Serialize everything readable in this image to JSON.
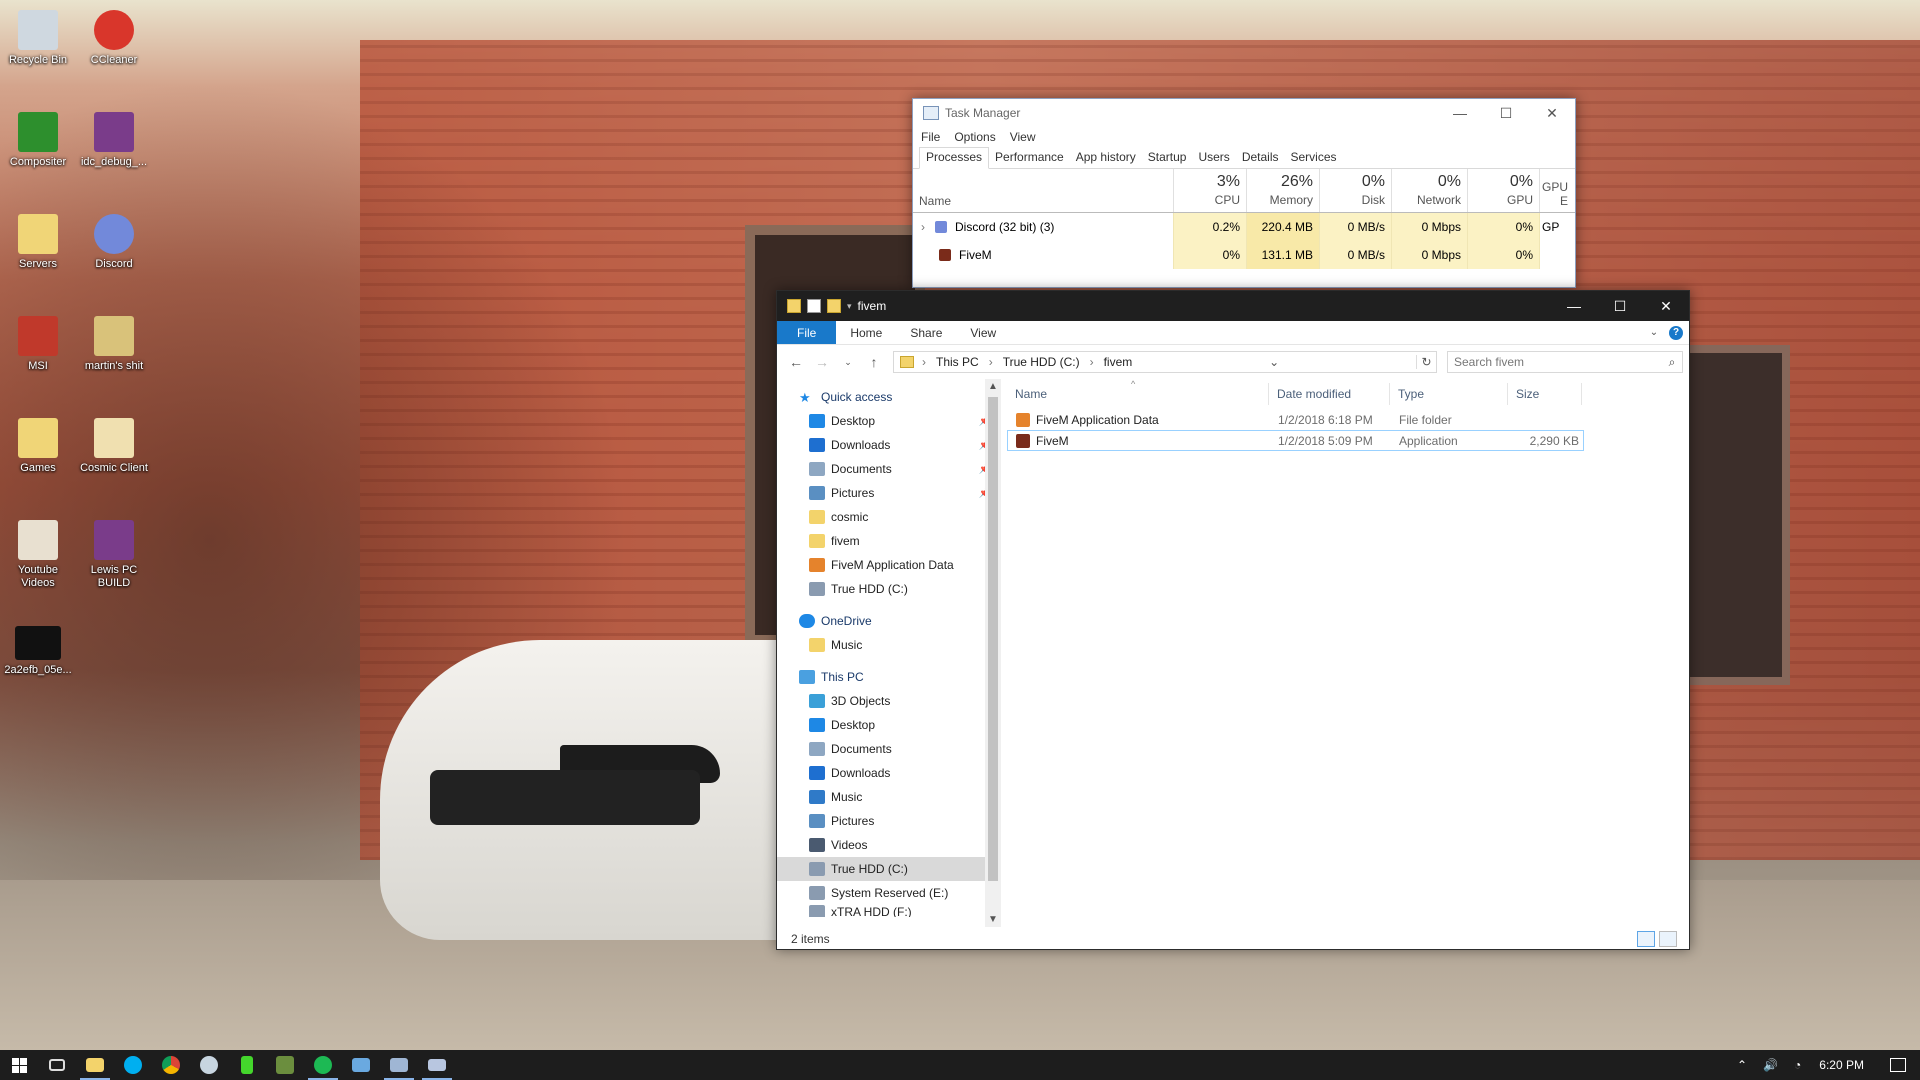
{
  "desktop": {
    "icons": [
      {
        "label": "Recycle Bin",
        "color": "#cfd8e0"
      },
      {
        "label": "CCleaner",
        "color": "#d9362b"
      },
      {
        "label": "Compositer",
        "color": "#2d8f2d"
      },
      {
        "label": "idc_debug_...",
        "color": "#7a3c8a"
      },
      {
        "label": "Servers",
        "color": "#f0d577"
      },
      {
        "label": "Discord",
        "color": "#7289da"
      },
      {
        "label": "MSI",
        "color": "#c0392b"
      },
      {
        "label": "martin's shit",
        "color": "#d9c27a"
      },
      {
        "label": "Games",
        "color": "#f0d577"
      },
      {
        "label": "Cosmic Client",
        "color": "#f0e0b0"
      },
      {
        "label": "Youtube Videos",
        "color": "#e8e0d0"
      },
      {
        "label": "Lewis PC BUILD",
        "color": "#7a3c8a"
      },
      {
        "label": "2a2efb_05e...",
        "color": "#111111"
      }
    ]
  },
  "task_manager": {
    "title": "Task Manager",
    "menu": [
      "File",
      "Options",
      "View"
    ],
    "tabs": [
      "Processes",
      "Performance",
      "App history",
      "Startup",
      "Users",
      "Details",
      "Services"
    ],
    "columns": {
      "name": "Name",
      "cpu": {
        "pct": "3%",
        "label": "CPU"
      },
      "memory": {
        "pct": "26%",
        "label": "Memory"
      },
      "disk": {
        "pct": "0%",
        "label": "Disk"
      },
      "network": {
        "pct": "0%",
        "label": "Network"
      },
      "gpu": {
        "pct": "0%",
        "label": "GPU"
      },
      "gpu_engine": "GPU E"
    },
    "rows": [
      {
        "name": "Discord (32 bit) (3)",
        "cpu": "0.2%",
        "memory": "220.4 MB",
        "disk": "0 MB/s",
        "network": "0 Mbps",
        "gpu": "0%",
        "gpu_engine": "GP"
      },
      {
        "name": "FiveM",
        "cpu": "0%",
        "memory": "131.1 MB",
        "disk": "0 MB/s",
        "network": "0 Mbps",
        "gpu": "0%",
        "gpu_engine": ""
      }
    ]
  },
  "explorer": {
    "title": "fivem",
    "ribbon": [
      "File",
      "Home",
      "Share",
      "View"
    ],
    "breadcrumb": [
      "This PC",
      "True HDD (C:)",
      "fivem"
    ],
    "search_placeholder": "Search fivem",
    "nav": {
      "quick_access": "Quick access",
      "quick_items": [
        {
          "label": "Desktop",
          "pinned": true,
          "color": "#1e88e5"
        },
        {
          "label": "Downloads",
          "pinned": true,
          "color": "#1e6fd0"
        },
        {
          "label": "Documents",
          "pinned": true,
          "color": "#8ea7c2"
        },
        {
          "label": "Pictures",
          "pinned": true,
          "color": "#5a8fc2"
        },
        {
          "label": "cosmic",
          "pinned": false,
          "color": "#f3d36b"
        },
        {
          "label": "fivem",
          "pinned": false,
          "color": "#f3d36b"
        },
        {
          "label": "FiveM Application Data",
          "pinned": false,
          "color": "#e5832c"
        },
        {
          "label": "True HDD (C:)",
          "pinned": false,
          "color": "#8a9bb0"
        }
      ],
      "onedrive": "OneDrive",
      "onedrive_items": [
        {
          "label": "Music",
          "color": "#f3d36b"
        }
      ],
      "this_pc": "This PC",
      "pc_items": [
        {
          "label": "3D Objects",
          "color": "#3aa0d8"
        },
        {
          "label": "Desktop",
          "color": "#1e88e5"
        },
        {
          "label": "Documents",
          "color": "#8ea7c2"
        },
        {
          "label": "Downloads",
          "color": "#1e6fd0"
        },
        {
          "label": "Music",
          "color": "#2f7ac8"
        },
        {
          "label": "Pictures",
          "color": "#5a8fc2"
        },
        {
          "label": "Videos",
          "color": "#4a5a70"
        },
        {
          "label": "True HDD (C:)",
          "color": "#8a9bb0",
          "selected": true
        },
        {
          "label": "System Reserved (E:)",
          "color": "#8a9bb0"
        },
        {
          "label": "xTRA HDD (F:)",
          "color": "#8a9bb0"
        }
      ]
    },
    "columns": [
      "Name",
      "Date modified",
      "Type",
      "Size"
    ],
    "files": [
      {
        "name": "FiveM Application Data",
        "date": "1/2/2018 6:18 PM",
        "type": "File folder",
        "size": "",
        "color": "#e5832c"
      },
      {
        "name": "FiveM",
        "date": "1/2/2018 5:09 PM",
        "type": "Application",
        "size": "2,290 KB",
        "color": "#7a2b1a"
      }
    ],
    "status": "2 items"
  },
  "taskbar": {
    "apps": [
      {
        "name": "task-view",
        "color": "#dddddd"
      },
      {
        "name": "file-explorer",
        "color": "#f3d36b"
      },
      {
        "name": "skype",
        "color": "#00aff0"
      },
      {
        "name": "chrome",
        "color": "#e4c441"
      },
      {
        "name": "steam",
        "color": "#c7d5e0"
      },
      {
        "name": "razer",
        "color": "#44d62c"
      },
      {
        "name": "minecraft",
        "color": "#6b8e3e"
      },
      {
        "name": "spotify",
        "color": "#1db954"
      },
      {
        "name": "app-window",
        "color": "#6aa9e0"
      },
      {
        "name": "task-manager",
        "color": "#9fb6d4"
      },
      {
        "name": "remote-window",
        "color": "#b8c6e0"
      }
    ],
    "time": "6:20 PM"
  }
}
